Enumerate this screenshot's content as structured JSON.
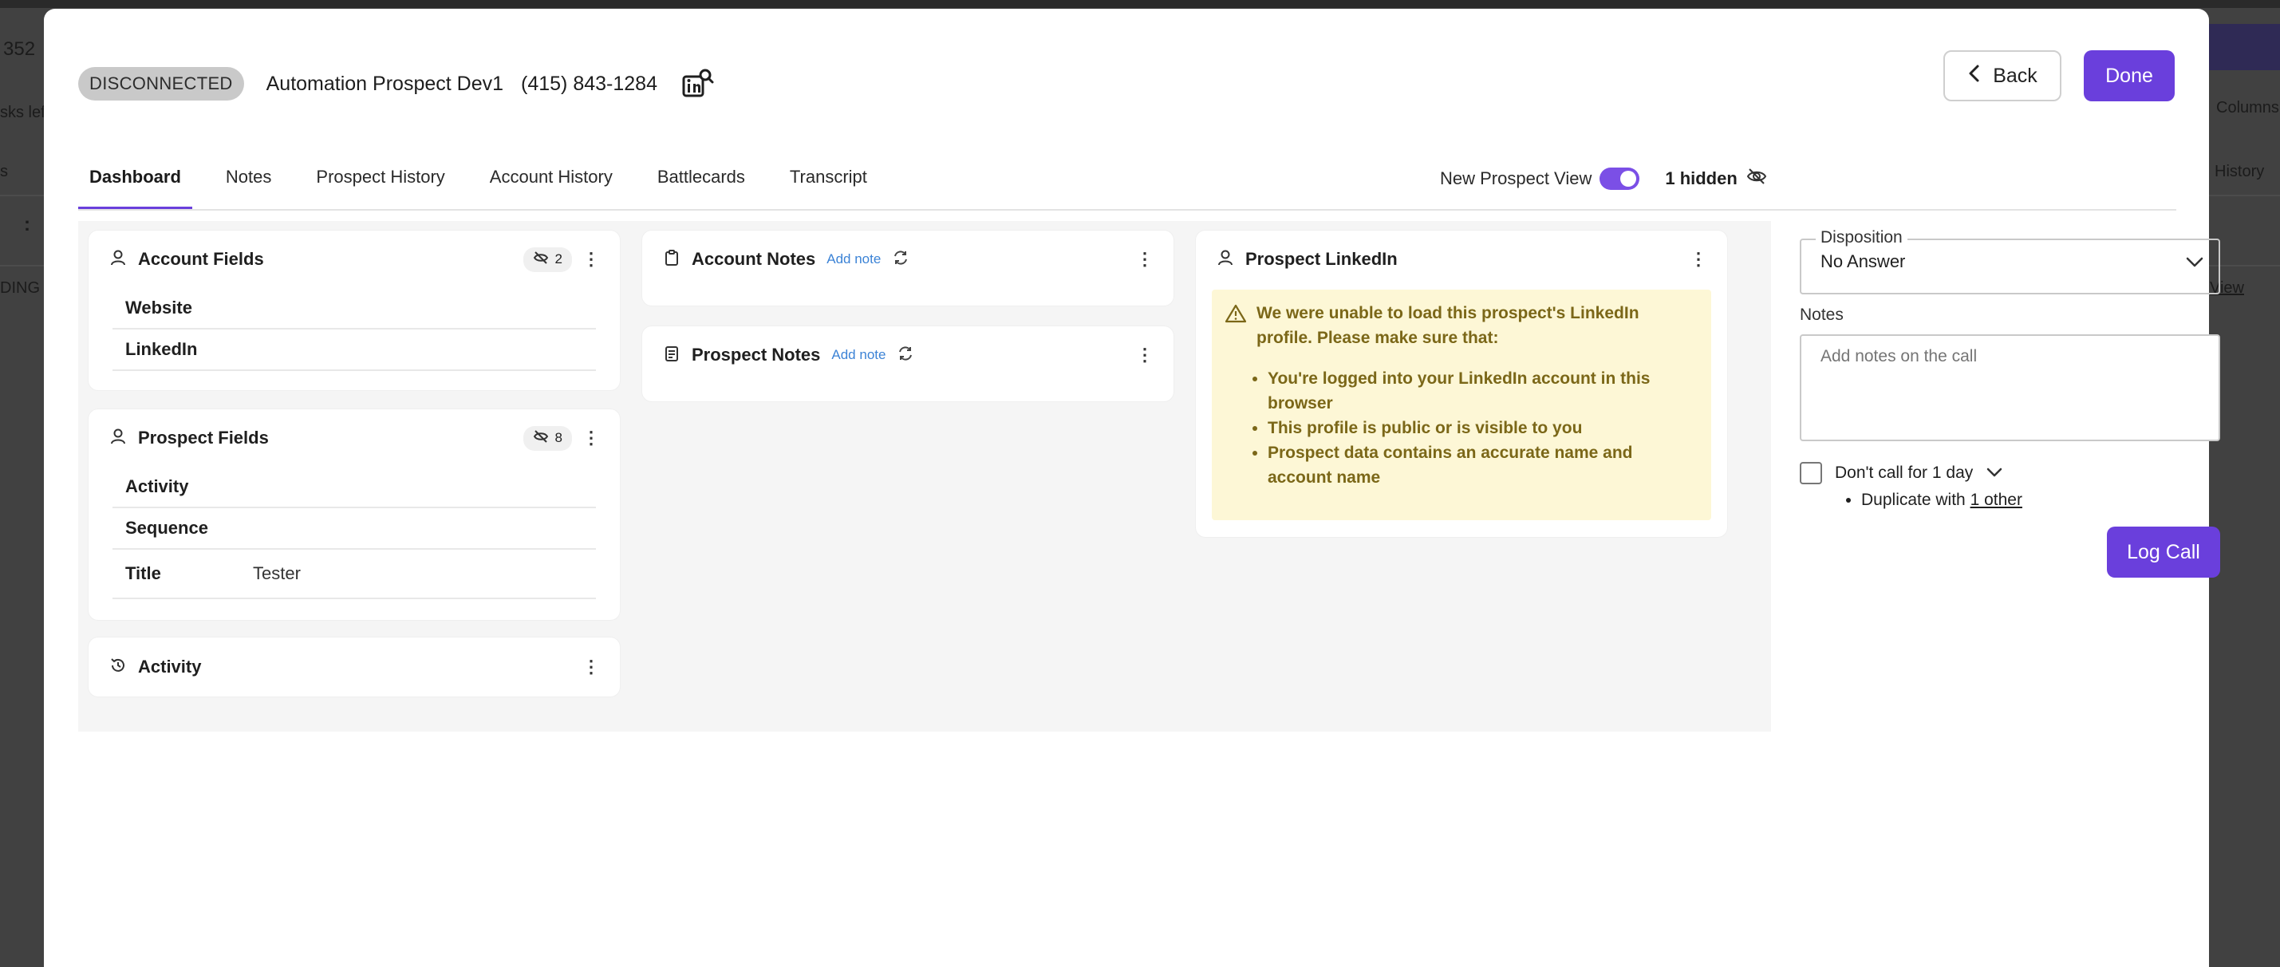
{
  "background": {
    "left_texts": [
      "352",
      "sks lef",
      "s",
      ":",
      "DING"
    ],
    "right_texts": [
      "Columns",
      "History",
      "View"
    ]
  },
  "header": {
    "status": "DISCONNECTED",
    "prospect_name": "Automation Prospect Dev1",
    "phone": "(415) 843-1284",
    "back_label": "Back",
    "done_label": "Done"
  },
  "tabs": [
    {
      "label": "Dashboard",
      "active": true
    },
    {
      "label": "Notes"
    },
    {
      "label": "Prospect History"
    },
    {
      "label": "Account History"
    },
    {
      "label": "Battlecards"
    },
    {
      "label": "Transcript"
    }
  ],
  "view": {
    "toggle_label": "New Prospect View",
    "toggle_on": true,
    "hidden_label": "1 hidden"
  },
  "account_fields": {
    "title": "Account Fields",
    "hidden_count": "2",
    "rows": [
      {
        "label": "Website",
        "value": ""
      },
      {
        "label": "LinkedIn",
        "value": ""
      }
    ]
  },
  "prospect_fields": {
    "title": "Prospect Fields",
    "hidden_count": "8",
    "rows": [
      {
        "label": "Activity",
        "value": ""
      },
      {
        "label": "Sequence",
        "value": ""
      },
      {
        "label": "Title",
        "value": "Tester"
      }
    ]
  },
  "activity": {
    "title": "Activity"
  },
  "account_notes": {
    "title": "Account Notes",
    "add_label": "Add note"
  },
  "prospect_notes": {
    "title": "Prospect Notes",
    "add_label": "Add note"
  },
  "linkedin": {
    "title": "Prospect LinkedIn",
    "warning_head": "We were unable to load this prospect's LinkedIn profile. Please make sure that:",
    "items": [
      "You're logged into your LinkedIn account in this browser",
      "This profile is public or is visible to you",
      "Prospect data contains an accurate name and account name"
    ]
  },
  "disposition": {
    "label": "Disposition",
    "value": "No Answer"
  },
  "notes": {
    "label": "Notes",
    "placeholder": "Add notes on the call"
  },
  "dont_call": {
    "label": "Don't call for 1 day",
    "checked": false
  },
  "duplicate": {
    "prefix": "Duplicate with ",
    "link": "1 other"
  },
  "log_call_label": "Log Call",
  "colors": {
    "accent": "#6a3fdc",
    "warning_bg": "#fdf7d6",
    "warning_text": "#7b6718",
    "link": "#3c83d6"
  }
}
